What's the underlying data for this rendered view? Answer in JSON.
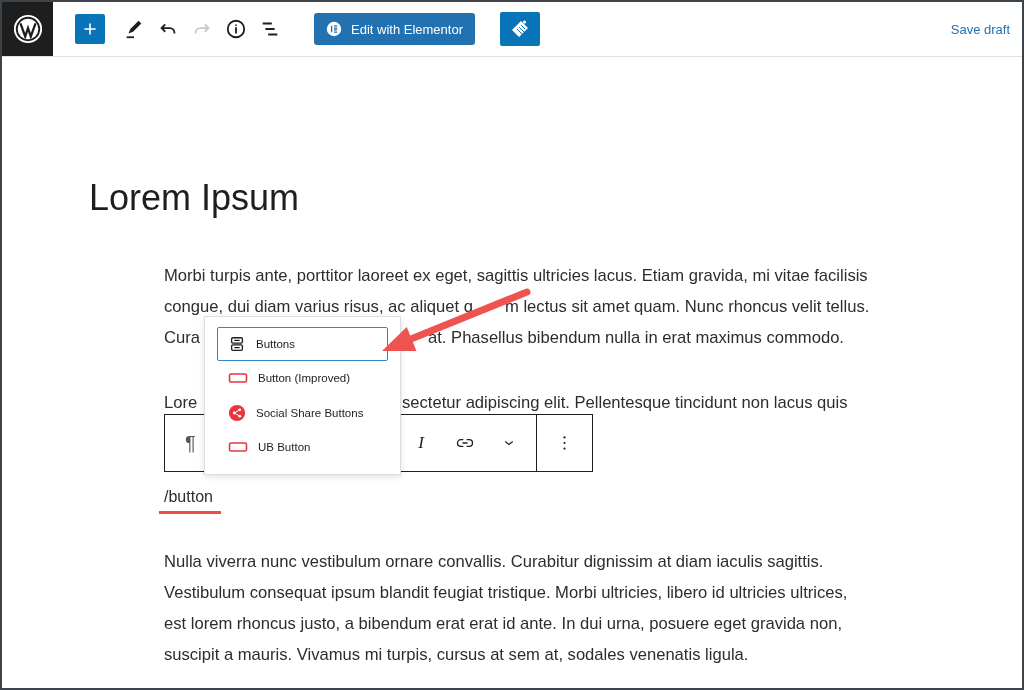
{
  "top_bar": {
    "tools": [
      {
        "kind": "add",
        "disabled": false
      },
      {
        "kind": "pen",
        "disabled": false
      },
      {
        "kind": "undo",
        "disabled": false
      },
      {
        "kind": "redo",
        "disabled": true
      },
      {
        "kind": "info",
        "disabled": false
      },
      {
        "kind": "outline",
        "disabled": false
      }
    ],
    "edit_button": "Edit with Elementor",
    "save": "Save draft"
  },
  "title": "Lorem Ipsum",
  "paragraphs_before": [
    {
      "lines": [
        [
          "Morbi turpis ante, porttitor laoreet ex eget, sagittis ultricies lacus. Etiam gravida, mi vitae facilisis"
        ],
        [
          "congue, dui diam varius risus, ac aliquet q",
          "m lectus sit amet quam. Nunc rhoncus velit tellus."
        ],
        [
          "Cura",
          "at. Phasellus bibendum nulla in erat maximus commodo."
        ]
      ]
    },
    {
      "lines": [
        [
          "Lore",
          "sectetur adipiscing elit. Pellentesque tincidunt non lacus quis"
        ]
      ]
    }
  ],
  "command": "/button",
  "paragraphs_after": [
    {
      "lines": [
        [
          "Nulla viverra nunc vestibulum ornare convallis. Curabitur dignissim at diam iaculis sagittis."
        ],
        [
          "Vestibulum consequat ipsum blandit feugiat tristique. Morbi ultricies, libero id ultricies ultrices,"
        ],
        [
          "est lorem rhoncus justo, a bibendum erat erat id ante. In dui urna, posuere eget gravida non,"
        ],
        [
          "suscipit a mauris. Vivamus mi turpis, cursus at sem at, sodales venenatis ligula."
        ]
      ]
    }
  ],
  "block_toolbar": {
    "glyph": "¶",
    "tools": [
      {
        "kind": "italic",
        "label": "I"
      },
      {
        "kind": "link"
      },
      {
        "kind": "more-rich"
      },
      {
        "kind": "options"
      }
    ]
  },
  "inserter": {
    "items": [
      {
        "label": "Buttons",
        "kind": "stack",
        "selected": true
      },
      {
        "label": "Button (Improved)",
        "kind": "outline",
        "selected": false
      },
      {
        "label": "Social Share Buttons",
        "kind": "share",
        "selected": false
      },
      {
        "label": "UB Button",
        "kind": "outline",
        "selected": false
      }
    ]
  }
}
